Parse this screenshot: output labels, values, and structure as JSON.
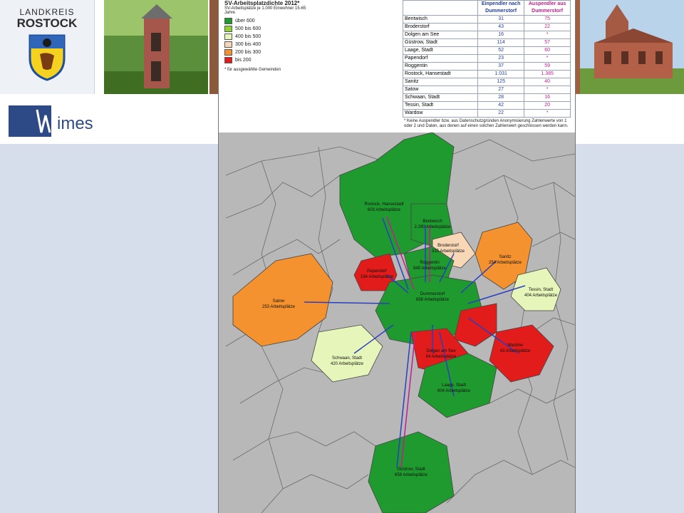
{
  "header": {
    "logo_line1": "LANDKREIS",
    "logo_line2": "ROSTOCK",
    "brand": "imes"
  },
  "legend": {
    "title": "SV-Arbeitsplatzdichte 2012*",
    "subtitle": "SV-Arbeitsplätze je 1.000 Einwohner 15-65 Jahre",
    "items": [
      {
        "label": "über 600",
        "color": "#1f9a2f"
      },
      {
        "label": "500 bis 600",
        "color": "#8fd032"
      },
      {
        "label": "400 bis 500",
        "color": "#e6f5b9"
      },
      {
        "label": "300 bis 400",
        "color": "#f8d7b7"
      },
      {
        "label": "200 bis 300",
        "color": "#f4922f"
      },
      {
        "label": "bis 200",
        "color": "#e21b1b"
      }
    ],
    "note": "* für ausgewählte Gemeinden"
  },
  "table": {
    "head_in": "Einpendler nach Dummerstorf",
    "head_out": "Auspendler aus Dummerstorf",
    "rows": [
      {
        "name": "Bentwisch",
        "in": "31",
        "out": "75"
      },
      {
        "name": "Broderstorf",
        "in": "43",
        "out": "22"
      },
      {
        "name": "Dolgen am See",
        "in": "16",
        "out": "*"
      },
      {
        "name": "Güstrow, Stadt",
        "in": "114",
        "out": "57"
      },
      {
        "name": "Laage, Stadt",
        "in": "52",
        "out": "60"
      },
      {
        "name": "Papendorf",
        "in": "23",
        "out": "*"
      },
      {
        "name": "Roggentin",
        "in": "37",
        "out": "59"
      },
      {
        "name": "Rostock, Hansestadt",
        "in": "1.031",
        "out": "1.385"
      },
      {
        "name": "Sanitz",
        "in": "125",
        "out": "40"
      },
      {
        "name": "Satow",
        "in": "27",
        "out": "*"
      },
      {
        "name": "Schwaan, Stadt",
        "in": "28",
        "out": "16"
      },
      {
        "name": "Tessin, Stadt",
        "in": "42",
        "out": "20"
      },
      {
        "name": "Wardow",
        "in": "22",
        "out": "*"
      }
    ],
    "footnote": "* Keine Auspendler bzw. aus Datenschutzgründen Anonymisierung Zahlenwerte von 1 oder 2 und Daten, aus denen auf einen solchen Zahlenwert geschlossen werden kann."
  },
  "map_labels": {
    "rostock": [
      "Rostock, Hansestadt",
      "603 Arbeitsplätze"
    ],
    "bentwisch": [
      "Bentwisch",
      "2.290 Arbeitsplätze"
    ],
    "broderstorf": [
      "Broderstorf",
      "315 Arbeitsplätze"
    ],
    "sanitz": [
      "Sanitz",
      "254 Arbeitsplätze"
    ],
    "roggentin": [
      "Roggentin",
      "849 Arbeitsplätze"
    ],
    "papendorf": [
      "Papendorf",
      "194 Arbeitsplätze"
    ],
    "satow": [
      "Satow",
      "253 Arbeitsplätze"
    ],
    "dummerstorf": [
      "Dummerstorf",
      "658 Arbeitsplätze"
    ],
    "tessin": [
      "Tessin, Stadt",
      "404 Arbeitsplätze"
    ],
    "wardow": [
      "Wardow",
      "43 Arbeitsplätze"
    ],
    "dolgen": [
      "Dolgen am See",
      "64 Arbeitsplätze"
    ],
    "schwaan": [
      "Schwaan, Stadt",
      "420 Arbeitsplätze"
    ],
    "laage": [
      "Laage, Stadt",
      "604 Arbeitsplätze"
    ],
    "guestrow": [
      "Güstrow, Stadt",
      "658 Arbeitsplätze"
    ]
  }
}
